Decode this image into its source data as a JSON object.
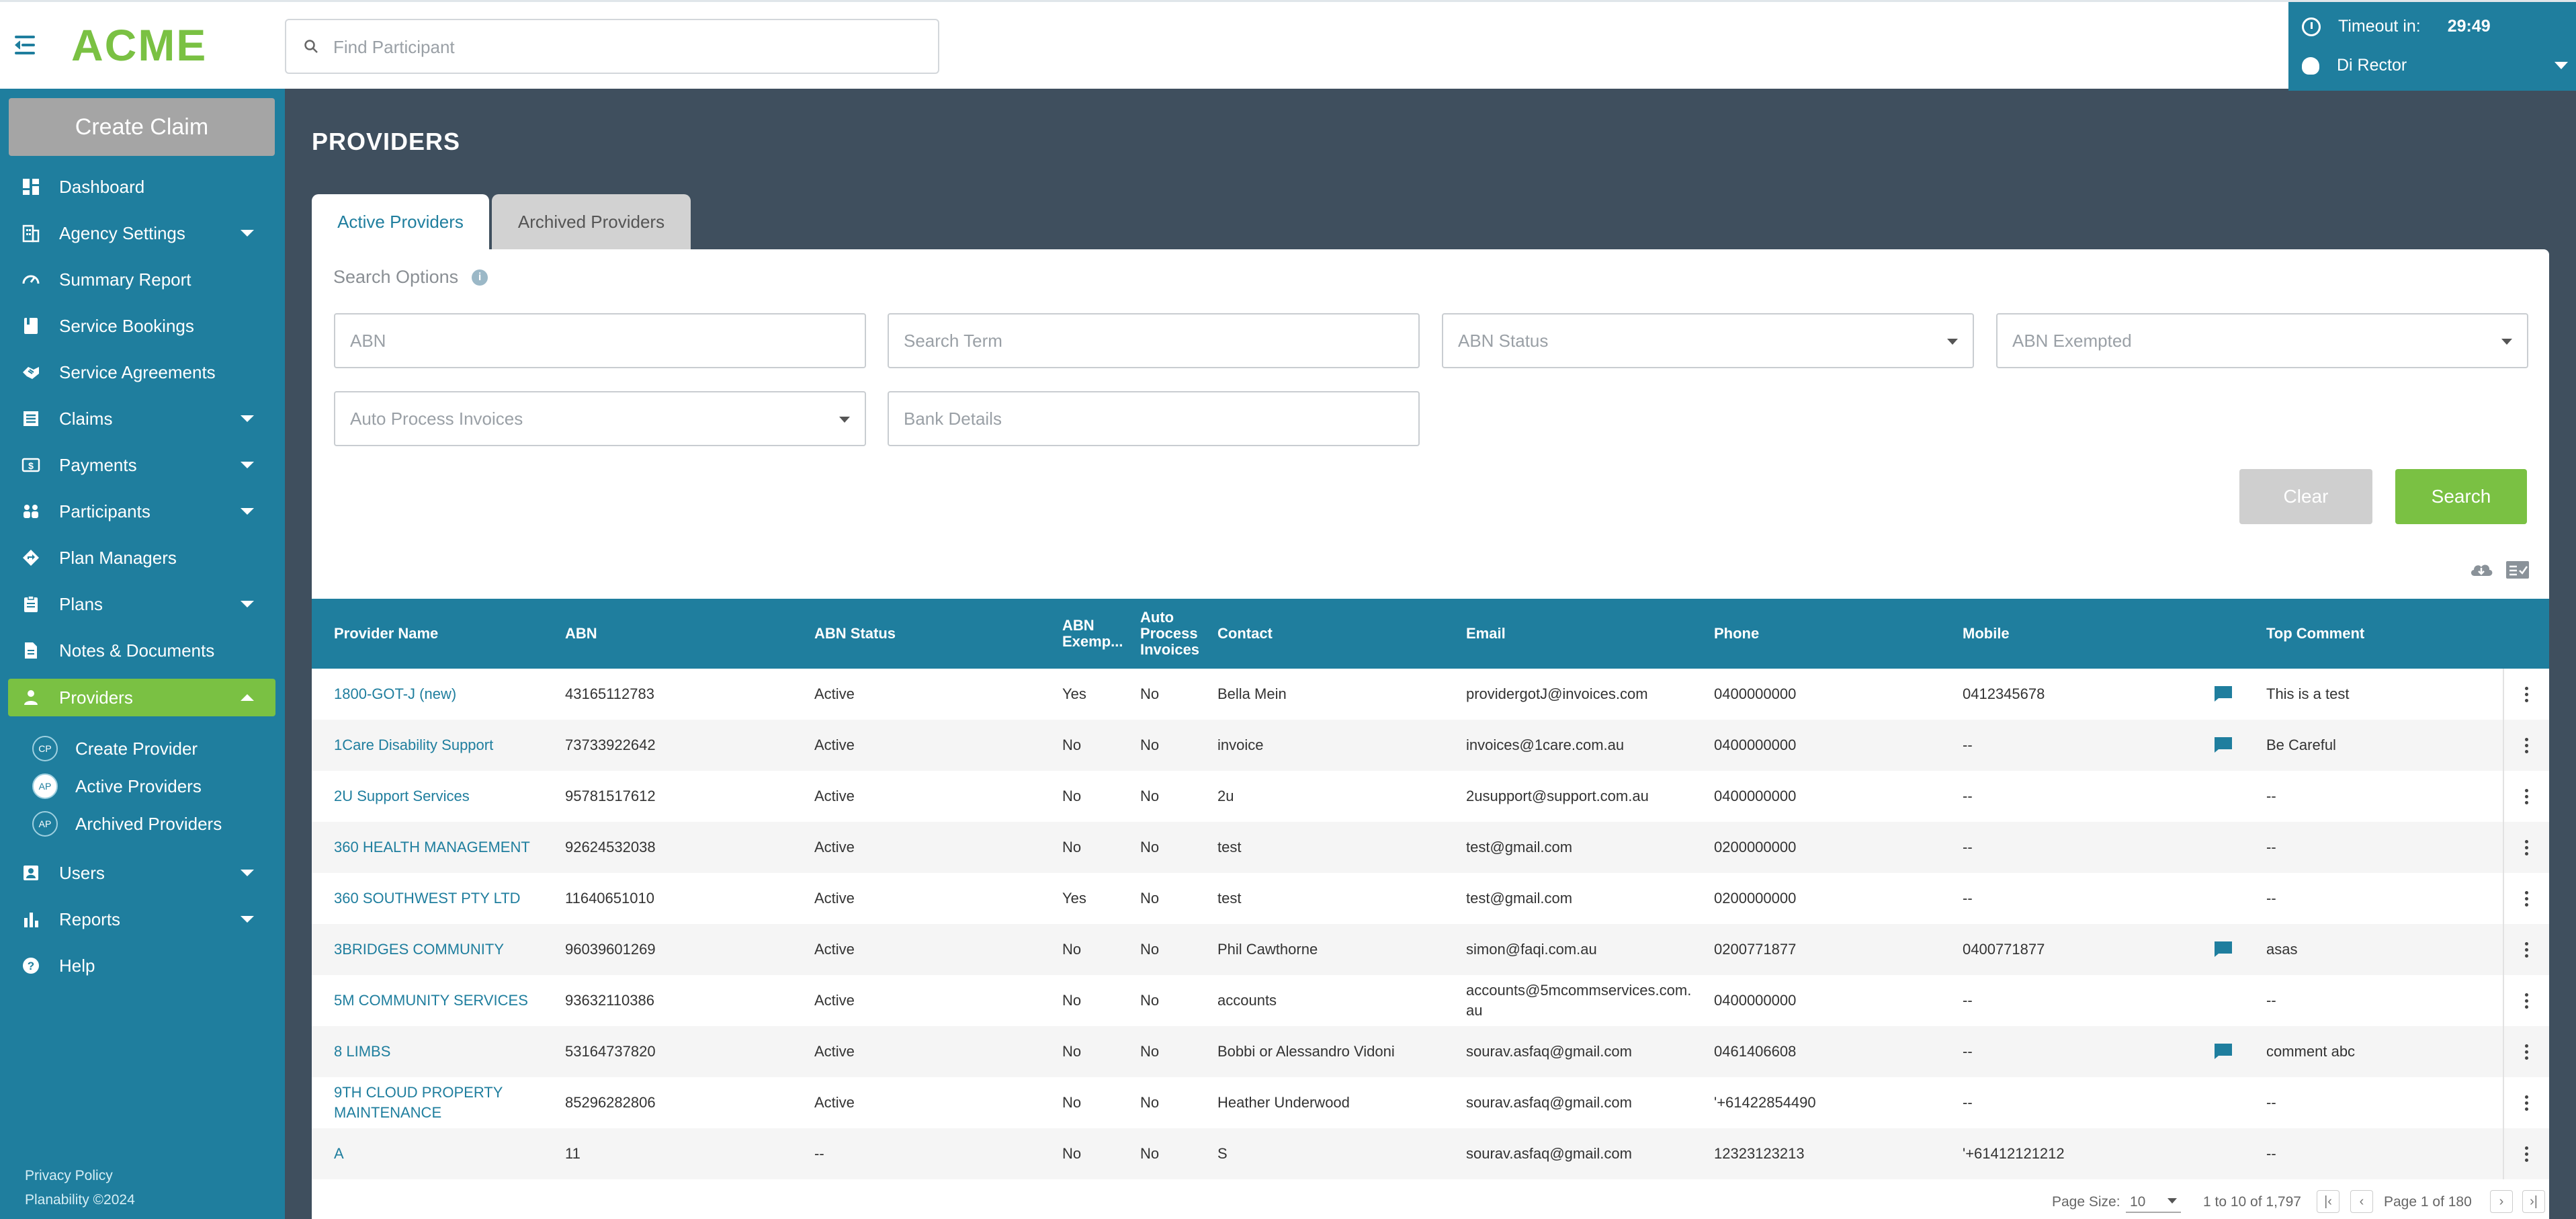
{
  "header": {
    "logo": "ACME",
    "find_placeholder": "Find Participant",
    "timeout_label": "Timeout in:",
    "timeout_value": "29:49",
    "user_name": "Di Rector"
  },
  "sidebar": {
    "create_claim": "Create Claim",
    "items": [
      {
        "label": "Dashboard"
      },
      {
        "label": "Agency Settings"
      },
      {
        "label": "Summary Report"
      },
      {
        "label": "Service Bookings"
      },
      {
        "label": "Service Agreements"
      },
      {
        "label": "Claims"
      },
      {
        "label": "Payments"
      },
      {
        "label": "Participants"
      },
      {
        "label": "Plan Managers"
      },
      {
        "label": "Plans"
      },
      {
        "label": "Notes & Documents"
      },
      {
        "label": "Providers"
      },
      {
        "label": "Users"
      },
      {
        "label": "Reports"
      },
      {
        "label": "Help"
      }
    ],
    "sub_items": [
      {
        "badge": "CP",
        "label": "Create Provider"
      },
      {
        "badge": "AP",
        "label": "Active Providers"
      },
      {
        "badge": "AP",
        "label": "Archived Providers"
      }
    ],
    "footer_privacy": "Privacy Policy",
    "footer_copyright": "Planability ©2024"
  },
  "main": {
    "title": "PROVIDERS",
    "tabs": [
      {
        "label": "Active Providers"
      },
      {
        "label": "Archived Providers"
      }
    ],
    "search_options_label": "Search Options",
    "fields": {
      "abn": "ABN",
      "search_term": "Search Term",
      "abn_status": "ABN Status",
      "abn_exempted": "ABN Exempted",
      "auto_process": "Auto Process Invoices",
      "bank_details": "Bank Details"
    },
    "clear_label": "Clear",
    "search_label": "Search"
  },
  "table": {
    "headers": {
      "provider_name": "Provider Name",
      "abn": "ABN",
      "abn_status": "ABN Status",
      "abn_exempted_1": "ABN",
      "abn_exempted_2": "Exemp...",
      "auto_1": "Auto",
      "auto_2": "Process",
      "auto_3": "Invoices",
      "contact": "Contact",
      "email": "Email",
      "phone": "Phone",
      "mobile": "Mobile",
      "top_comment": "Top Comment"
    },
    "rows": [
      {
        "name": "1800-GOT-J (new)",
        "name2": "",
        "abn": "43165112783",
        "status": "Active",
        "exempt": "Yes",
        "auto": "No",
        "contact": "Bella Mein",
        "email": "providergotJ@invoices.com",
        "email2": "",
        "phone": "0400000000",
        "mobile": "0412345678",
        "comment": "This is a test",
        "has_comment": true
      },
      {
        "name": "1Care Disability Support",
        "name2": "",
        "abn": "73733922642",
        "status": "Active",
        "exempt": "No",
        "auto": "No",
        "contact": "invoice",
        "email": "invoices@1care.com.au",
        "email2": "",
        "phone": "0400000000",
        "mobile": "--",
        "comment": "Be Careful",
        "has_comment": true
      },
      {
        "name": "2U Support Services",
        "name2": "",
        "abn": "95781517612",
        "status": "Active",
        "exempt": "No",
        "auto": "No",
        "contact": "2u",
        "email": "2usupport@support.com.au",
        "email2": "",
        "phone": "0400000000",
        "mobile": "--",
        "comment": "--",
        "has_comment": false
      },
      {
        "name": "360 HEALTH MANAGEMENT",
        "name2": "",
        "abn": "92624532038",
        "status": "Active",
        "exempt": "No",
        "auto": "No",
        "contact": "test",
        "email": "test@gmail.com",
        "email2": "",
        "phone": "0200000000",
        "mobile": "--",
        "comment": "--",
        "has_comment": false
      },
      {
        "name": "360 SOUTHWEST PTY LTD",
        "name2": "",
        "abn": "11640651010",
        "status": "Active",
        "exempt": "Yes",
        "auto": "No",
        "contact": "test",
        "email": "test@gmail.com",
        "email2": "",
        "phone": "0200000000",
        "mobile": "--",
        "comment": "--",
        "has_comment": false
      },
      {
        "name": "3BRIDGES COMMUNITY",
        "name2": "",
        "abn": "96039601269",
        "status": "Active",
        "exempt": "No",
        "auto": "No",
        "contact": "Phil Cawthorne",
        "email": "simon@faqi.com.au",
        "email2": "",
        "phone": "0200771877",
        "mobile": "0400771877",
        "comment": "asas",
        "has_comment": true
      },
      {
        "name": "5M COMMUNITY SERVICES",
        "name2": "",
        "abn": "93632110386",
        "status": "Active",
        "exempt": "No",
        "auto": "No",
        "contact": "accounts",
        "email": "accounts@5mcommservices.com.",
        "email2": "au",
        "phone": "0400000000",
        "mobile": "--",
        "comment": "--",
        "has_comment": false
      },
      {
        "name": "8 LIMBS",
        "name2": "",
        "abn": "53164737820",
        "status": "Active",
        "exempt": "No",
        "auto": "No",
        "contact": "Bobbi or Alessandro Vidoni",
        "email": "sourav.asfaq@gmail.com",
        "email2": "",
        "phone": "0461406608",
        "mobile": "--",
        "comment": "comment abc",
        "has_comment": true
      },
      {
        "name": "9TH CLOUD PROPERTY",
        "name2": "MAINTENANCE",
        "abn": "85296282806",
        "status": "Active",
        "exempt": "No",
        "auto": "No",
        "contact": "Heather Underwood",
        "email": "sourav.asfaq@gmail.com",
        "email2": "",
        "phone": "'+61422854490",
        "mobile": "--",
        "comment": "--",
        "has_comment": false
      },
      {
        "name": "A",
        "name2": "",
        "abn": "11",
        "status": "--",
        "exempt": "No",
        "auto": "No",
        "contact": "S",
        "email": "sourav.asfaq@gmail.com",
        "email2": "",
        "phone": "12323123213",
        "mobile": "'+61412121212",
        "comment": "--",
        "has_comment": false
      }
    ]
  },
  "pager": {
    "page_size_label": "Page Size:",
    "page_size": "10",
    "range": "1 to 10 of 1,797",
    "page_text": "Page 1 of 180"
  },
  "colors": {
    "brand_teal": "#1f7e9e",
    "brand_green": "#7ac143",
    "backdrop": "#3f4f5e"
  }
}
